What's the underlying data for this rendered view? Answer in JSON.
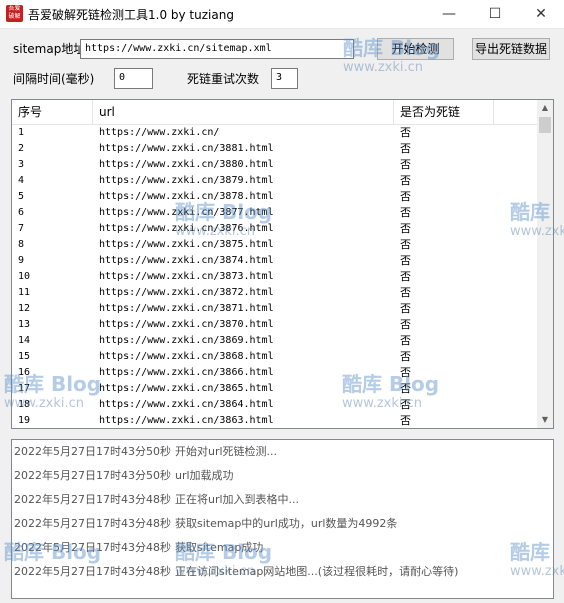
{
  "window": {
    "title": "吾爱破解死链检测工具1.0 by tuziang",
    "icon_text": "吾爱破解",
    "minimize_glyph": "—",
    "maximize_glyph": "☐",
    "close_glyph": "✕"
  },
  "form": {
    "sitemap_label": "sitemap地址",
    "sitemap_value": "https://www.zxki.cn/sitemap.xml",
    "interval_label": "间隔时间(毫秒)",
    "interval_value": "0",
    "retry_label": "死链重试次数",
    "retry_value": "3",
    "start_button": "开始检测",
    "export_button": "导出死链数据"
  },
  "table": {
    "columns": [
      "序号",
      "url",
      "是否为死链"
    ],
    "rows": [
      [
        "1",
        "https://www.zxki.cn/",
        "否"
      ],
      [
        "2",
        "https://www.zxki.cn/3881.html",
        "否"
      ],
      [
        "3",
        "https://www.zxki.cn/3880.html",
        "否"
      ],
      [
        "4",
        "https://www.zxki.cn/3879.html",
        "否"
      ],
      [
        "5",
        "https://www.zxki.cn/3878.html",
        "否"
      ],
      [
        "6",
        "https://www.zxki.cn/3877.html",
        "否"
      ],
      [
        "7",
        "https://www.zxki.cn/3876.html",
        "否"
      ],
      [
        "8",
        "https://www.zxki.cn/3875.html",
        "否"
      ],
      [
        "9",
        "https://www.zxki.cn/3874.html",
        "否"
      ],
      [
        "10",
        "https://www.zxki.cn/3873.html",
        "否"
      ],
      [
        "11",
        "https://www.zxki.cn/3872.html",
        "否"
      ],
      [
        "12",
        "https://www.zxki.cn/3871.html",
        "否"
      ],
      [
        "13",
        "https://www.zxki.cn/3870.html",
        "否"
      ],
      [
        "14",
        "https://www.zxki.cn/3869.html",
        "否"
      ],
      [
        "15",
        "https://www.zxki.cn/3868.html",
        "否"
      ],
      [
        "16",
        "https://www.zxki.cn/3866.html",
        "否"
      ],
      [
        "17",
        "https://www.zxki.cn/3865.html",
        "否"
      ],
      [
        "18",
        "https://www.zxki.cn/3864.html",
        "否"
      ],
      [
        "19",
        "https://www.zxki.cn/3863.html",
        "否"
      ]
    ]
  },
  "log": [
    {
      "time": "2022年5月27日17时43分50秒",
      "msg": "开始对url死链检测..."
    },
    {
      "time": "2022年5月27日17时43分50秒",
      "msg": "url加载成功"
    },
    {
      "time": "2022年5月27日17时43分48秒",
      "msg": "正在将url加入到表格中..."
    },
    {
      "time": "2022年5月27日17时43分48秒",
      "msg": "获取sitemap中的url成功，url数量为4992条"
    },
    {
      "time": "2022年5月27日17时43分48秒",
      "msg": "获取sitemap成功"
    },
    {
      "time": "2022年5月27日17时43分48秒",
      "msg": "正在访问sitemap网站地图...(该过程很耗时，请耐心等待)"
    }
  ],
  "watermark": {
    "brand": "酷库 Blog",
    "brand_short": "酷库",
    "url": "www.zxki.cn"
  },
  "colors": {
    "accent_red": "#c81e1e",
    "watermark_blue": "#5b90c8"
  }
}
